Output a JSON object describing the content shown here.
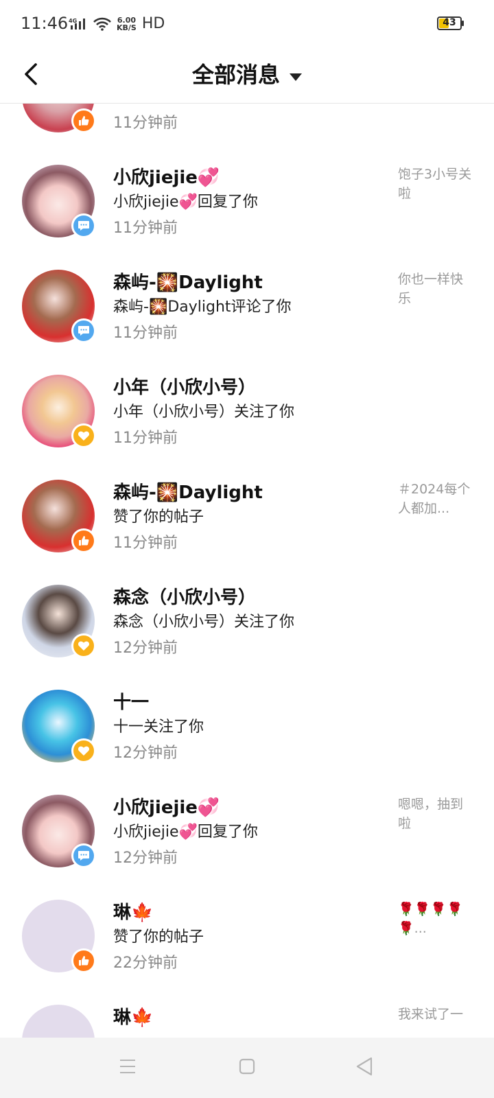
{
  "status_bar": {
    "time": "11:46",
    "network": "4G",
    "speed_value": "6.00",
    "speed_unit": "KB/S",
    "hd": "HD",
    "battery": "43"
  },
  "header": {
    "title": "全部消息"
  },
  "colors": {
    "like_badge": "#ff7a1a",
    "comment_badge": "#52a8ef",
    "follow_badge": "#f9b11b"
  },
  "messages": [
    {
      "name": "",
      "action": "",
      "time": "11分钟前",
      "badge": "like-icon",
      "preview": ""
    },
    {
      "name": "小欣jiejie💞",
      "action": "小欣jiejie💞回复了你",
      "time": "11分钟前",
      "badge": "comment-icon",
      "preview": "饱子3小号关啦"
    },
    {
      "name": "森屿-🎇Daylight",
      "action": "森屿-🎇Daylight评论了你",
      "time": "11分钟前",
      "badge": "comment-icon",
      "preview": "你也一样快乐"
    },
    {
      "name": "小年（小欣小号）",
      "action": "小年（小欣小号）关注了你",
      "time": "11分钟前",
      "badge": "heart-icon",
      "preview": ""
    },
    {
      "name": "森屿-🎇Daylight",
      "action": "赞了你的帖子",
      "time": "11分钟前",
      "badge": "like-icon",
      "preview": "＃2024每个人都加..."
    },
    {
      "name": "森念（小欣小号）",
      "action": "森念（小欣小号）关注了你",
      "time": "12分钟前",
      "badge": "heart-icon",
      "preview": ""
    },
    {
      "name": "十一",
      "action": "十一关注了你",
      "time": "12分钟前",
      "badge": "heart-icon",
      "preview": ""
    },
    {
      "name": "小欣jiejie💞",
      "action": "小欣jiejie💞回复了你",
      "time": "12分钟前",
      "badge": "comment-icon",
      "preview": "嗯嗯，抽到啦"
    },
    {
      "name": "琳🍁",
      "action": "赞了你的帖子",
      "time": "22分钟前",
      "badge": "like-icon",
      "preview": "🌹🌹🌹🌹🌹..."
    },
    {
      "name": "琳🍁",
      "action": "",
      "time": "",
      "badge": "",
      "preview": "我来试了一"
    }
  ],
  "bottom_nav": {
    "menu": "menu-icon",
    "home": "home-icon",
    "back": "back-triangle-icon"
  }
}
